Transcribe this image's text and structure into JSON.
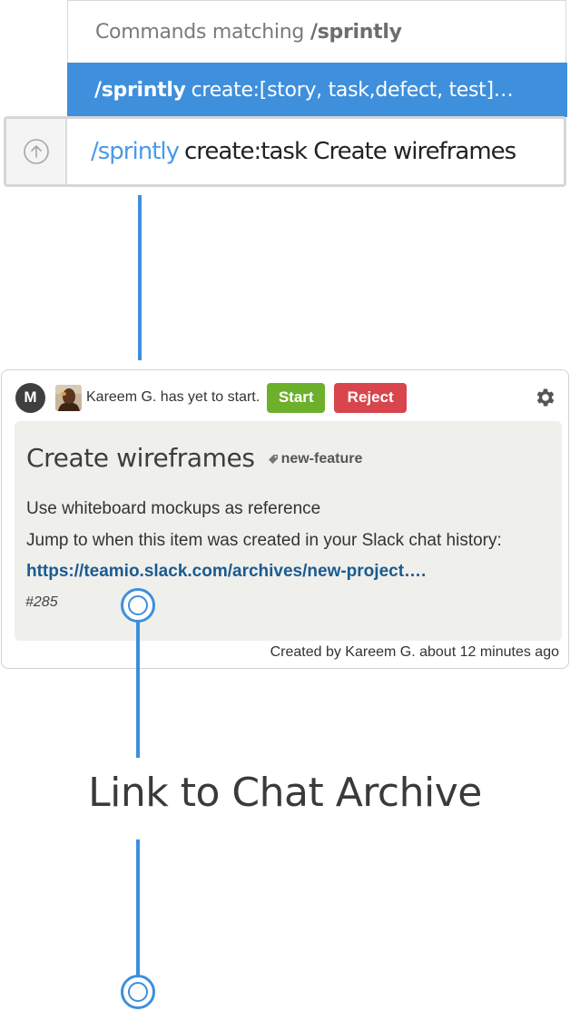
{
  "command_popup": {
    "header_prefix": "Commands matching",
    "header_command": "/sprintly",
    "suggestion_command": "/sprintly",
    "suggestion_args": "create:[story, task,defect, test]…"
  },
  "message_input": {
    "command": "/sprintly",
    "text": "create:task Create wireframes"
  },
  "card": {
    "avatar_initial": "M",
    "status": "Kareem G. has yet to start.",
    "start_label": "Start",
    "reject_label": "Reject",
    "title": "Create wireframes",
    "tag": "new-feature",
    "description": "Use whiteboard mockups as reference",
    "jump_text": "Jump to when this item was created in your Slack chat history:",
    "link": "https://teamio.slack.com/archives/new-project….",
    "item_id": "#285",
    "footer": "Created by Kareem G. about 12 minutes ago"
  },
  "annotation": {
    "label": "Link to Chat Archive"
  },
  "colors": {
    "accent": "#3e8fdc",
    "start": "#6cb02b",
    "reject": "#d9454c",
    "link": "#1a5b8f"
  },
  "icons": [
    "upload-arrow-icon",
    "tag-icon",
    "gear-icon"
  ]
}
